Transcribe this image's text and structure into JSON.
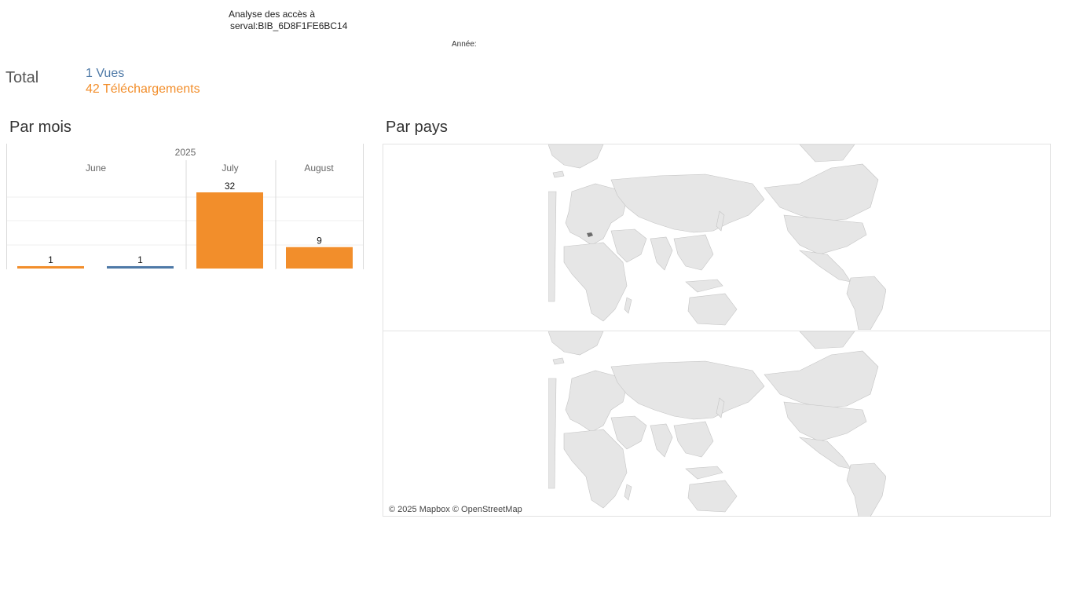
{
  "header": {
    "title_line1": "Analyse des accès à",
    "title_line2": "serval:BIB_6D8F1FE6BC14",
    "year_filter_label": "Année:"
  },
  "totals": {
    "label": "Total",
    "views": "1 Vues",
    "downloads": "42 Téléchargements"
  },
  "sections": {
    "by_month": "Par mois",
    "by_country": "Par pays"
  },
  "colors": {
    "views": "#4e79a7",
    "downloads": "#f28e2b",
    "map_land": "#e6e6e6",
    "map_highlight": "#6b6b6b"
  },
  "chart_data": {
    "type": "bar",
    "year": "2025",
    "months": [
      "June",
      "July",
      "August"
    ],
    "bars": [
      {
        "month": "June",
        "series": "Téléchargements",
        "value": 1
      },
      {
        "month": "June",
        "series": "Vues",
        "value": 1
      },
      {
        "month": "July",
        "series": "Téléchargements",
        "value": 32
      },
      {
        "month": "August",
        "series": "Téléchargements",
        "value": 9
      }
    ],
    "ylim": [
      0,
      32
    ],
    "grid": true
  },
  "map": {
    "attribution": "© 2025 Mapbox © OpenStreetMap",
    "highlighted_country": "Switzerland"
  }
}
